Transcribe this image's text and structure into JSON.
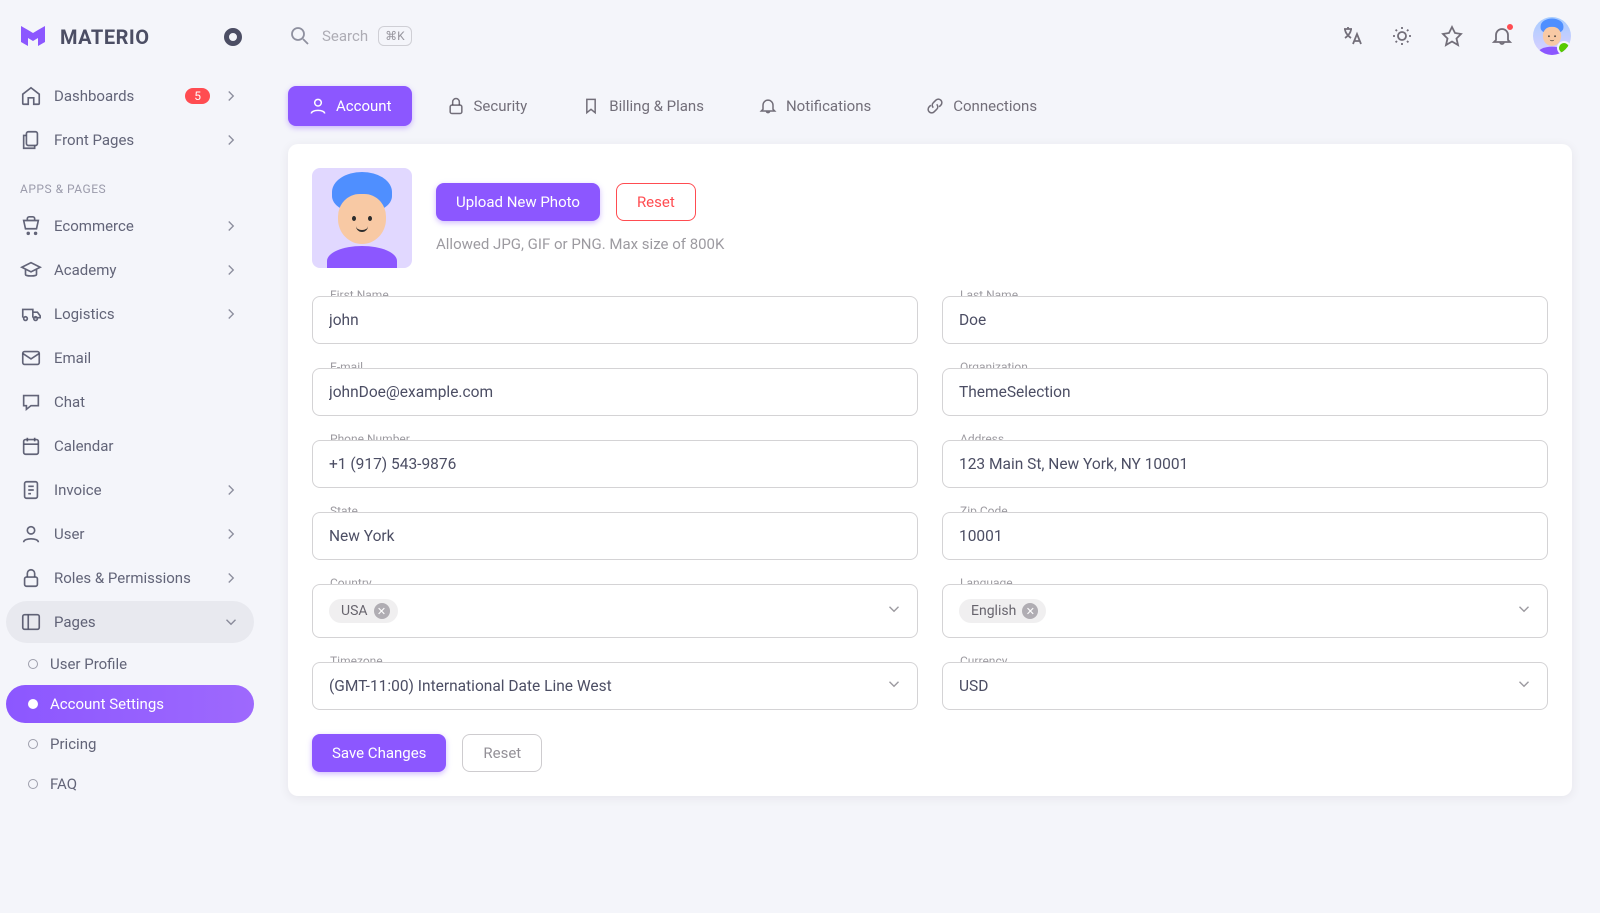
{
  "brand": {
    "name": "MATERIO"
  },
  "search": {
    "placeholder": "Search",
    "shortcut": "⌘K"
  },
  "sidebar": {
    "dashboards": {
      "label": "Dashboards",
      "badge": "5"
    },
    "front_pages": {
      "label": "Front Pages"
    },
    "section_apps": "APPS & PAGES",
    "ecommerce": {
      "label": "Ecommerce"
    },
    "academy": {
      "label": "Academy"
    },
    "logistics": {
      "label": "Logistics"
    },
    "email": {
      "label": "Email"
    },
    "chat": {
      "label": "Chat"
    },
    "calendar": {
      "label": "Calendar"
    },
    "invoice": {
      "label": "Invoice"
    },
    "user": {
      "label": "User"
    },
    "roles": {
      "label": "Roles & Permissions"
    },
    "pages": {
      "label": "Pages"
    },
    "sub": {
      "user_profile": "User Profile",
      "account_settings": "Account Settings",
      "pricing": "Pricing",
      "faq": "FAQ"
    }
  },
  "tabs": {
    "account": "Account",
    "security": "Security",
    "billing": "Billing & Plans",
    "notifications": "Notifications",
    "connections": "Connections"
  },
  "photo": {
    "upload": "Upload New Photo",
    "reset": "Reset",
    "hint": "Allowed JPG, GIF or PNG. Max size of 800K"
  },
  "form": {
    "first_name": {
      "label": "First Name",
      "value": "john"
    },
    "last_name": {
      "label": "Last Name",
      "value": "Doe"
    },
    "email": {
      "label": "E-mail",
      "value": "johnDoe@example.com"
    },
    "organization": {
      "label": "Organization",
      "value": "ThemeSelection"
    },
    "phone": {
      "label": "Phone Number",
      "value": "+1 (917) 543-9876"
    },
    "address": {
      "label": "Address",
      "value": "123 Main St, New York, NY 10001"
    },
    "state": {
      "label": "State",
      "value": "New York"
    },
    "zip": {
      "label": "Zip Code",
      "value": "10001"
    },
    "country": {
      "label": "Country",
      "chip": "USA"
    },
    "language": {
      "label": "Language",
      "chip": "English"
    },
    "timezone": {
      "label": "Timezone",
      "value": "(GMT-11:00) International Date Line West"
    },
    "currency": {
      "label": "Currency",
      "value": "USD"
    }
  },
  "actions": {
    "save": "Save Changes",
    "reset": "Reset"
  }
}
